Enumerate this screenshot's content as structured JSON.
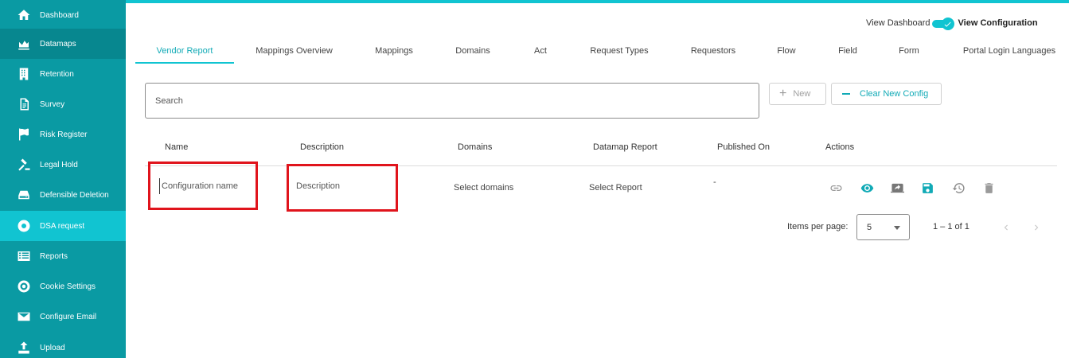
{
  "sidebar": {
    "items": [
      {
        "label": "Dashboard",
        "icon": "home-icon"
      },
      {
        "label": "Datamaps",
        "icon": "area-chart-icon"
      },
      {
        "label": "Retention",
        "icon": "building-icon"
      },
      {
        "label": "Survey",
        "icon": "document-icon"
      },
      {
        "label": "Risk Register",
        "icon": "flag-icon"
      },
      {
        "label": "Legal Hold",
        "icon": "gavel-icon"
      },
      {
        "label": "Defensible Deletion",
        "icon": "drive-icon"
      },
      {
        "label": "DSA request",
        "icon": "lifebuoy-icon"
      },
      {
        "label": "Reports",
        "icon": "list-icon"
      },
      {
        "label": "Cookie Settings",
        "icon": "gear-icon"
      },
      {
        "label": "Configure Email",
        "icon": "envelope-icon"
      },
      {
        "label": "Upload",
        "icon": "upload-icon"
      }
    ],
    "active_index": 7
  },
  "view_toggle": {
    "left_label": "View Dashboard",
    "right_label": "View Configuration",
    "checked": true
  },
  "tabs": [
    {
      "label": "Vendor Report",
      "active": true
    },
    {
      "label": "Mappings Overview",
      "active": false
    },
    {
      "label": "Mappings",
      "active": false
    },
    {
      "label": "Domains",
      "active": false
    },
    {
      "label": "Act",
      "active": false
    },
    {
      "label": "Request Types",
      "active": false
    },
    {
      "label": "Requestors",
      "active": false
    },
    {
      "label": "Flow",
      "active": false
    },
    {
      "label": "Field",
      "active": false
    },
    {
      "label": "Form",
      "active": false
    },
    {
      "label": "Portal Login Languages",
      "active": false
    }
  ],
  "search": {
    "placeholder": "Search",
    "value": ""
  },
  "toolbar": {
    "new_label": "New",
    "clear_label": "Clear New Config"
  },
  "table": {
    "columns": [
      "Name",
      "Description",
      "Domains",
      "Datamap Report",
      "Published On",
      "Actions"
    ],
    "new_row": {
      "name_placeholder": "Configuration name",
      "description_placeholder": "Description",
      "domains": "Select domains",
      "report": "Select Report",
      "published_on": "-"
    },
    "actions": [
      "link-icon",
      "eye-icon",
      "screen-share-icon",
      "save-icon",
      "history-icon",
      "trash-icon"
    ]
  },
  "paginator": {
    "label": "Items per page:",
    "page_size": "5",
    "range": "1 – 1 of 1"
  },
  "colors": {
    "sidebar": "#0a9aa3",
    "sidebar_active": "#11c4d1",
    "accent": "#11c4d1",
    "highlight": "#e0141c"
  }
}
